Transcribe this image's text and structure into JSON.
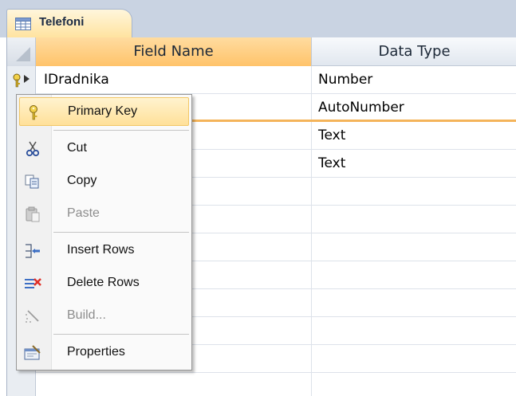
{
  "tab": {
    "label": "Telefoni",
    "icon": "table-icon"
  },
  "grid": {
    "headers": {
      "field_name": "Field Name",
      "data_type": "Data Type"
    },
    "rows": [
      {
        "field": "IDradnika",
        "type": "Number",
        "primary_key": true
      },
      {
        "field": "",
        "type": "AutoNumber"
      },
      {
        "field": "",
        "type": "Text"
      },
      {
        "field": "",
        "type": "Text"
      }
    ]
  },
  "context_menu": {
    "items": [
      {
        "label": "Primary Key",
        "icon": "key-icon",
        "enabled": true,
        "highlighted": true
      },
      {
        "label": "Cut",
        "icon": "scissors-icon",
        "enabled": true
      },
      {
        "label": "Copy",
        "icon": "copy-icon",
        "enabled": true
      },
      {
        "label": "Paste",
        "icon": "paste-icon",
        "enabled": false
      },
      {
        "label": "Insert Rows",
        "icon": "insert-rows-icon",
        "enabled": true
      },
      {
        "label": "Delete Rows",
        "icon": "delete-rows-icon",
        "enabled": true
      },
      {
        "label": "Build...",
        "icon": "build-wand-icon",
        "enabled": false
      },
      {
        "label": "Properties",
        "icon": "properties-icon",
        "enabled": true
      }
    ]
  },
  "colors": {
    "accent": "#ffc36a",
    "highlight": "#ffe099",
    "tabstrip": "#c9d3e2"
  }
}
